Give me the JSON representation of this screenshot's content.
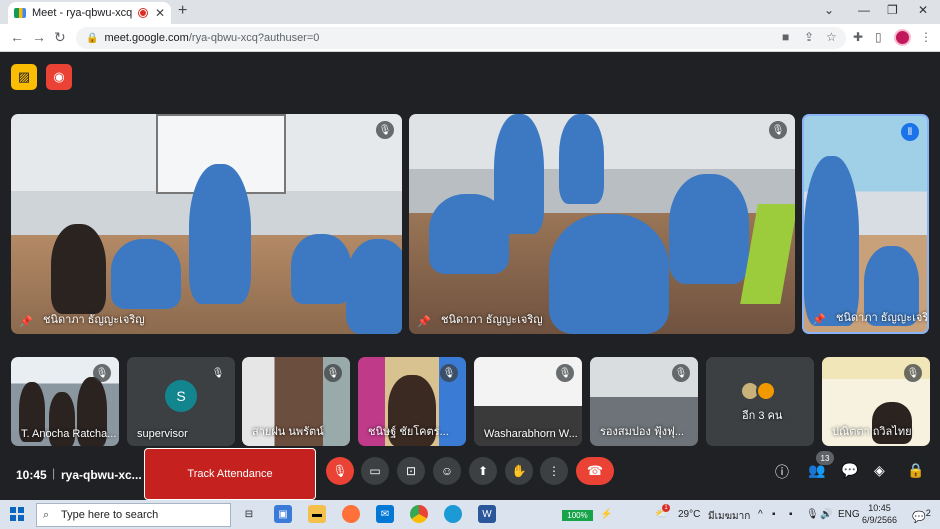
{
  "browser": {
    "tab_title": "Meet - rya-qbwu-xcq",
    "tab_close": "✕",
    "new_tab": "+",
    "url_host": "meet.google.com",
    "url_path": "/rya-qbwu-xcq?authuser=0"
  },
  "meet": {
    "main_tiles": [
      {
        "name": "ชนิดาภา ธัญญะเจริญ"
      },
      {
        "name": "ชนิดาภา ธัญญะเจริญ"
      },
      {
        "name": "ชนิดาภา ธัญญะเจริ..."
      }
    ],
    "small_tiles": [
      {
        "name": "T. Anocha Ratcha..."
      },
      {
        "name": "supervisor",
        "initial": "S"
      },
      {
        "name": "สายฝน นพรัตน์"
      },
      {
        "name": "ชนิษฐ์ ชัยโคตร..."
      },
      {
        "name": "Washarabhorn W..."
      },
      {
        "name": "รองสมปอง ฟุ้งฟุ..."
      },
      {
        "name": "อีก 3 คน"
      },
      {
        "name": "ปณิตตา ถวิลไทย"
      }
    ],
    "time": "10:45",
    "meeting_code": "rya-qbwu-xc...",
    "track_attendance": "Track Attendance",
    "participants_count": "13"
  },
  "taskbar": {
    "search_placeholder": "Type here to search",
    "battery": "100%",
    "temperature": "29°C",
    "weather_text": "มีเมฆมาก",
    "language": "ENG",
    "clock_time": "10:45",
    "clock_date": "6/9/2566",
    "notification_count": "2",
    "weather_alert": "1"
  },
  "colors": {
    "meet_bg": "#202124",
    "danger": "#ea4335",
    "track_bg": "#c5221f",
    "avatar_teal": "#12858f"
  }
}
